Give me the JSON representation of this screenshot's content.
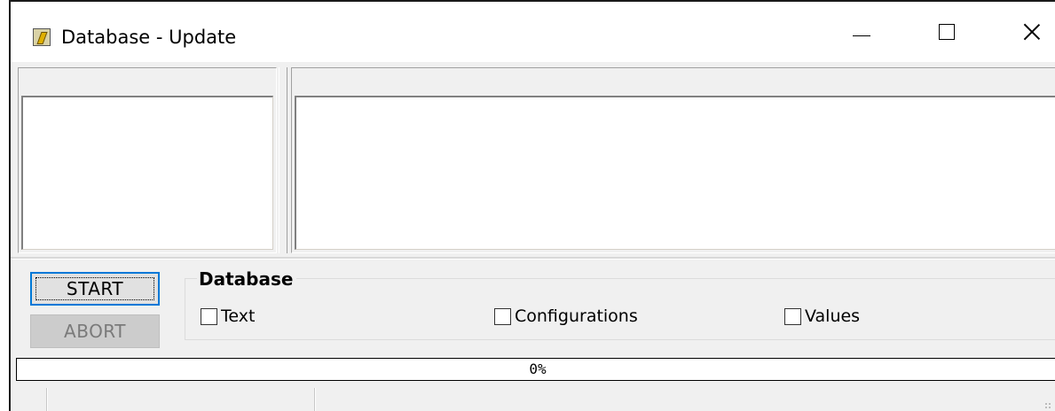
{
  "window": {
    "title": "Database - Update",
    "icon": "database-update-app-icon",
    "controls": {
      "minimize": "minimize-icon",
      "maximize": "maximize-icon",
      "close": "close-icon"
    }
  },
  "buttons": {
    "start_label": "START",
    "abort_label": "ABORT",
    "abort_enabled": false
  },
  "database_group": {
    "title": "Database",
    "options": [
      {
        "label": "Text",
        "checked": false
      },
      {
        "label": "Configurations",
        "checked": false
      },
      {
        "label": "Values",
        "checked": false
      }
    ]
  },
  "progress": {
    "percent": 0,
    "label": "0%"
  },
  "colors": {
    "focus_border": "#0078d7",
    "window_bg": "#f0f0f0",
    "progress_fill": "#06b025"
  }
}
